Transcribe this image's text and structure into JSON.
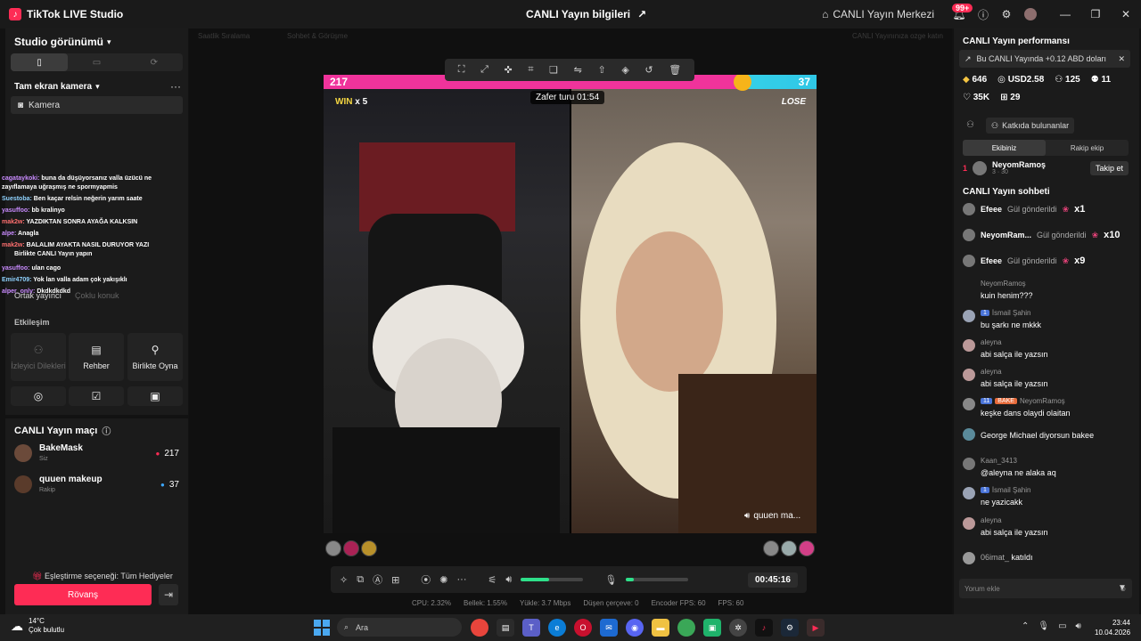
{
  "titlebar": {
    "app_name": "TikTok LIVE Studio",
    "center_title": "CANLI Yayın bilgileri",
    "live_center": "CANLI Yayın Merkezi",
    "notif_badge": "99+"
  },
  "left": {
    "studio_view": "Studio görünümü",
    "source_header": "Tam ekran kamera",
    "source_item": "Camera_label",
    "camera_label": "Kamera",
    "chat_overlay": [
      {
        "user": "cagataykoki:",
        "text": "buna da düşüyorsanız valla üzücü ne"
      },
      {
        "user": "",
        "text": "zayıflamaya uğraşmış ne spormyapmis"
      },
      {
        "user": "Suestoba:",
        "text": "Ben kaçar relsin neğerin yarım saate"
      },
      {
        "user": "yasuffoo:",
        "text": "bb kralinyo"
      },
      {
        "user": "mak2w:",
        "text": "YAZDIKTAN SONRA AYAĞA KALKSIN"
      },
      {
        "user": "alpe:",
        "text": "Anagla"
      },
      {
        "user": "mak2w:",
        "text": "BALALIM AYAKTA NASIL DURUYOR YAZI"
      },
      {
        "user": "",
        "text": "Birlikte CANLI Yayın yapın"
      },
      {
        "user": "yasuffoo:",
        "text": "ulan cago"
      },
      {
        "user": "Emir4709:",
        "text": "Yok lan valla adam çok yakışıklı"
      },
      {
        "user": "alper_only:",
        "text": "Dkdkdkdkd"
      }
    ],
    "cohost_tabs": [
      "Ortak yayıncı",
      "Çoklu konuk"
    ],
    "interaction_label": "Etkileşim",
    "tiles": [
      {
        "label": "İzleyici Dilekleri",
        "icon": "wish-icon"
      },
      {
        "label": "Rehber",
        "icon": "guide-icon"
      },
      {
        "label": "Birlikte Oyna",
        "icon": "play-together-icon"
      }
    ]
  },
  "match": {
    "title": "CANLI Yayın maçı",
    "players": [
      {
        "name": "BakeMask",
        "sub": "Siz",
        "score": "217"
      },
      {
        "name": "quuen makeup",
        "sub": "Rakip",
        "score": "37"
      }
    ],
    "option": "Eşleştirme seçeneği: Tüm Hediyeler",
    "rematch": "Rövanş"
  },
  "center": {
    "ghost_tabs": [
      "Saatlik Sıralama",
      "Sohbet & Görüşme",
      "CANLI Yayınınıza ozge katın"
    ],
    "score_left": "217",
    "score_right": "37",
    "score_share": 0.85,
    "win_label": "WIN",
    "win_count": "x 5",
    "lose_label": "LOSE",
    "timer": "Zafer turu 01:54",
    "opponent_tag": "quuen ma...",
    "duration": "00:45:16",
    "volume_level": 0.45,
    "mic_level": 0.12,
    "stats": [
      "CPU: 2.32%",
      "Bellek: 1.55%",
      "Yükle: 3.7 Mbps",
      "Düşen çerçeve: 0",
      "Encoder FPS: 60",
      "FPS: 60"
    ]
  },
  "right": {
    "perf_title": "CANLI Yayın performansı",
    "perf_banner": "Bu CANLI Yayında +0.12 ABD doları",
    "stats_row1": [
      "646",
      "USD2.58",
      "125",
      "11"
    ],
    "stats_row2": [
      "35K",
      "29"
    ],
    "contributors": "Katkıda bulunanlar",
    "seg_tabs": [
      "Ekibiniz",
      "Rakip ekip"
    ],
    "rank": {
      "num": "1",
      "name": "NeyomRamoş",
      "sub": "3 · 30",
      "follow": "Takip et"
    },
    "chat_title": "CANLI Yayın sohbeti",
    "gifts": [
      {
        "user": "Efeee",
        "text": "Gül gönderildi",
        "count": "x1"
      },
      {
        "user": "NeyomRam...",
        "text": "Gül gönderildi",
        "count": "x10"
      },
      {
        "user": "Efeee",
        "text": "Gül gönderildi",
        "count": "x9"
      }
    ],
    "messages": [
      {
        "name": "NeyomRamoş",
        "level": "",
        "text": "kuin henim???"
      },
      {
        "name": "İsmail Şahin",
        "level": "1",
        "text": "bu şarkı ne mkkk"
      },
      {
        "name": "aleyna",
        "level": "",
        "text": "abi salça ile yazsın"
      },
      {
        "name": "aleyna",
        "level": "",
        "text": "abi salça ile yazsın"
      },
      {
        "name": "NeyomRamoş",
        "level": "11",
        "text": "keşke dans olaydi olaitan"
      },
      {
        "name": "",
        "level": "",
        "text": "George Michael diyorsun bakee"
      },
      {
        "name": "Kaan_3413",
        "level": "",
        "text": "@aleyna ne alaka aq"
      },
      {
        "name": "İsmail Şahin",
        "level": "1",
        "text": "ne yazicakk"
      },
      {
        "name": "aleyna",
        "level": "",
        "text": "abi salça ile yazsın"
      }
    ],
    "join_user": "06imat_",
    "join_text": "katıldı",
    "comment_placeholder": "Yorum ekle"
  },
  "taskbar": {
    "temp": "14°C",
    "weather": "Çok bulutlu",
    "search": "Ara",
    "time": "23:44",
    "date": "10.04.2026"
  }
}
